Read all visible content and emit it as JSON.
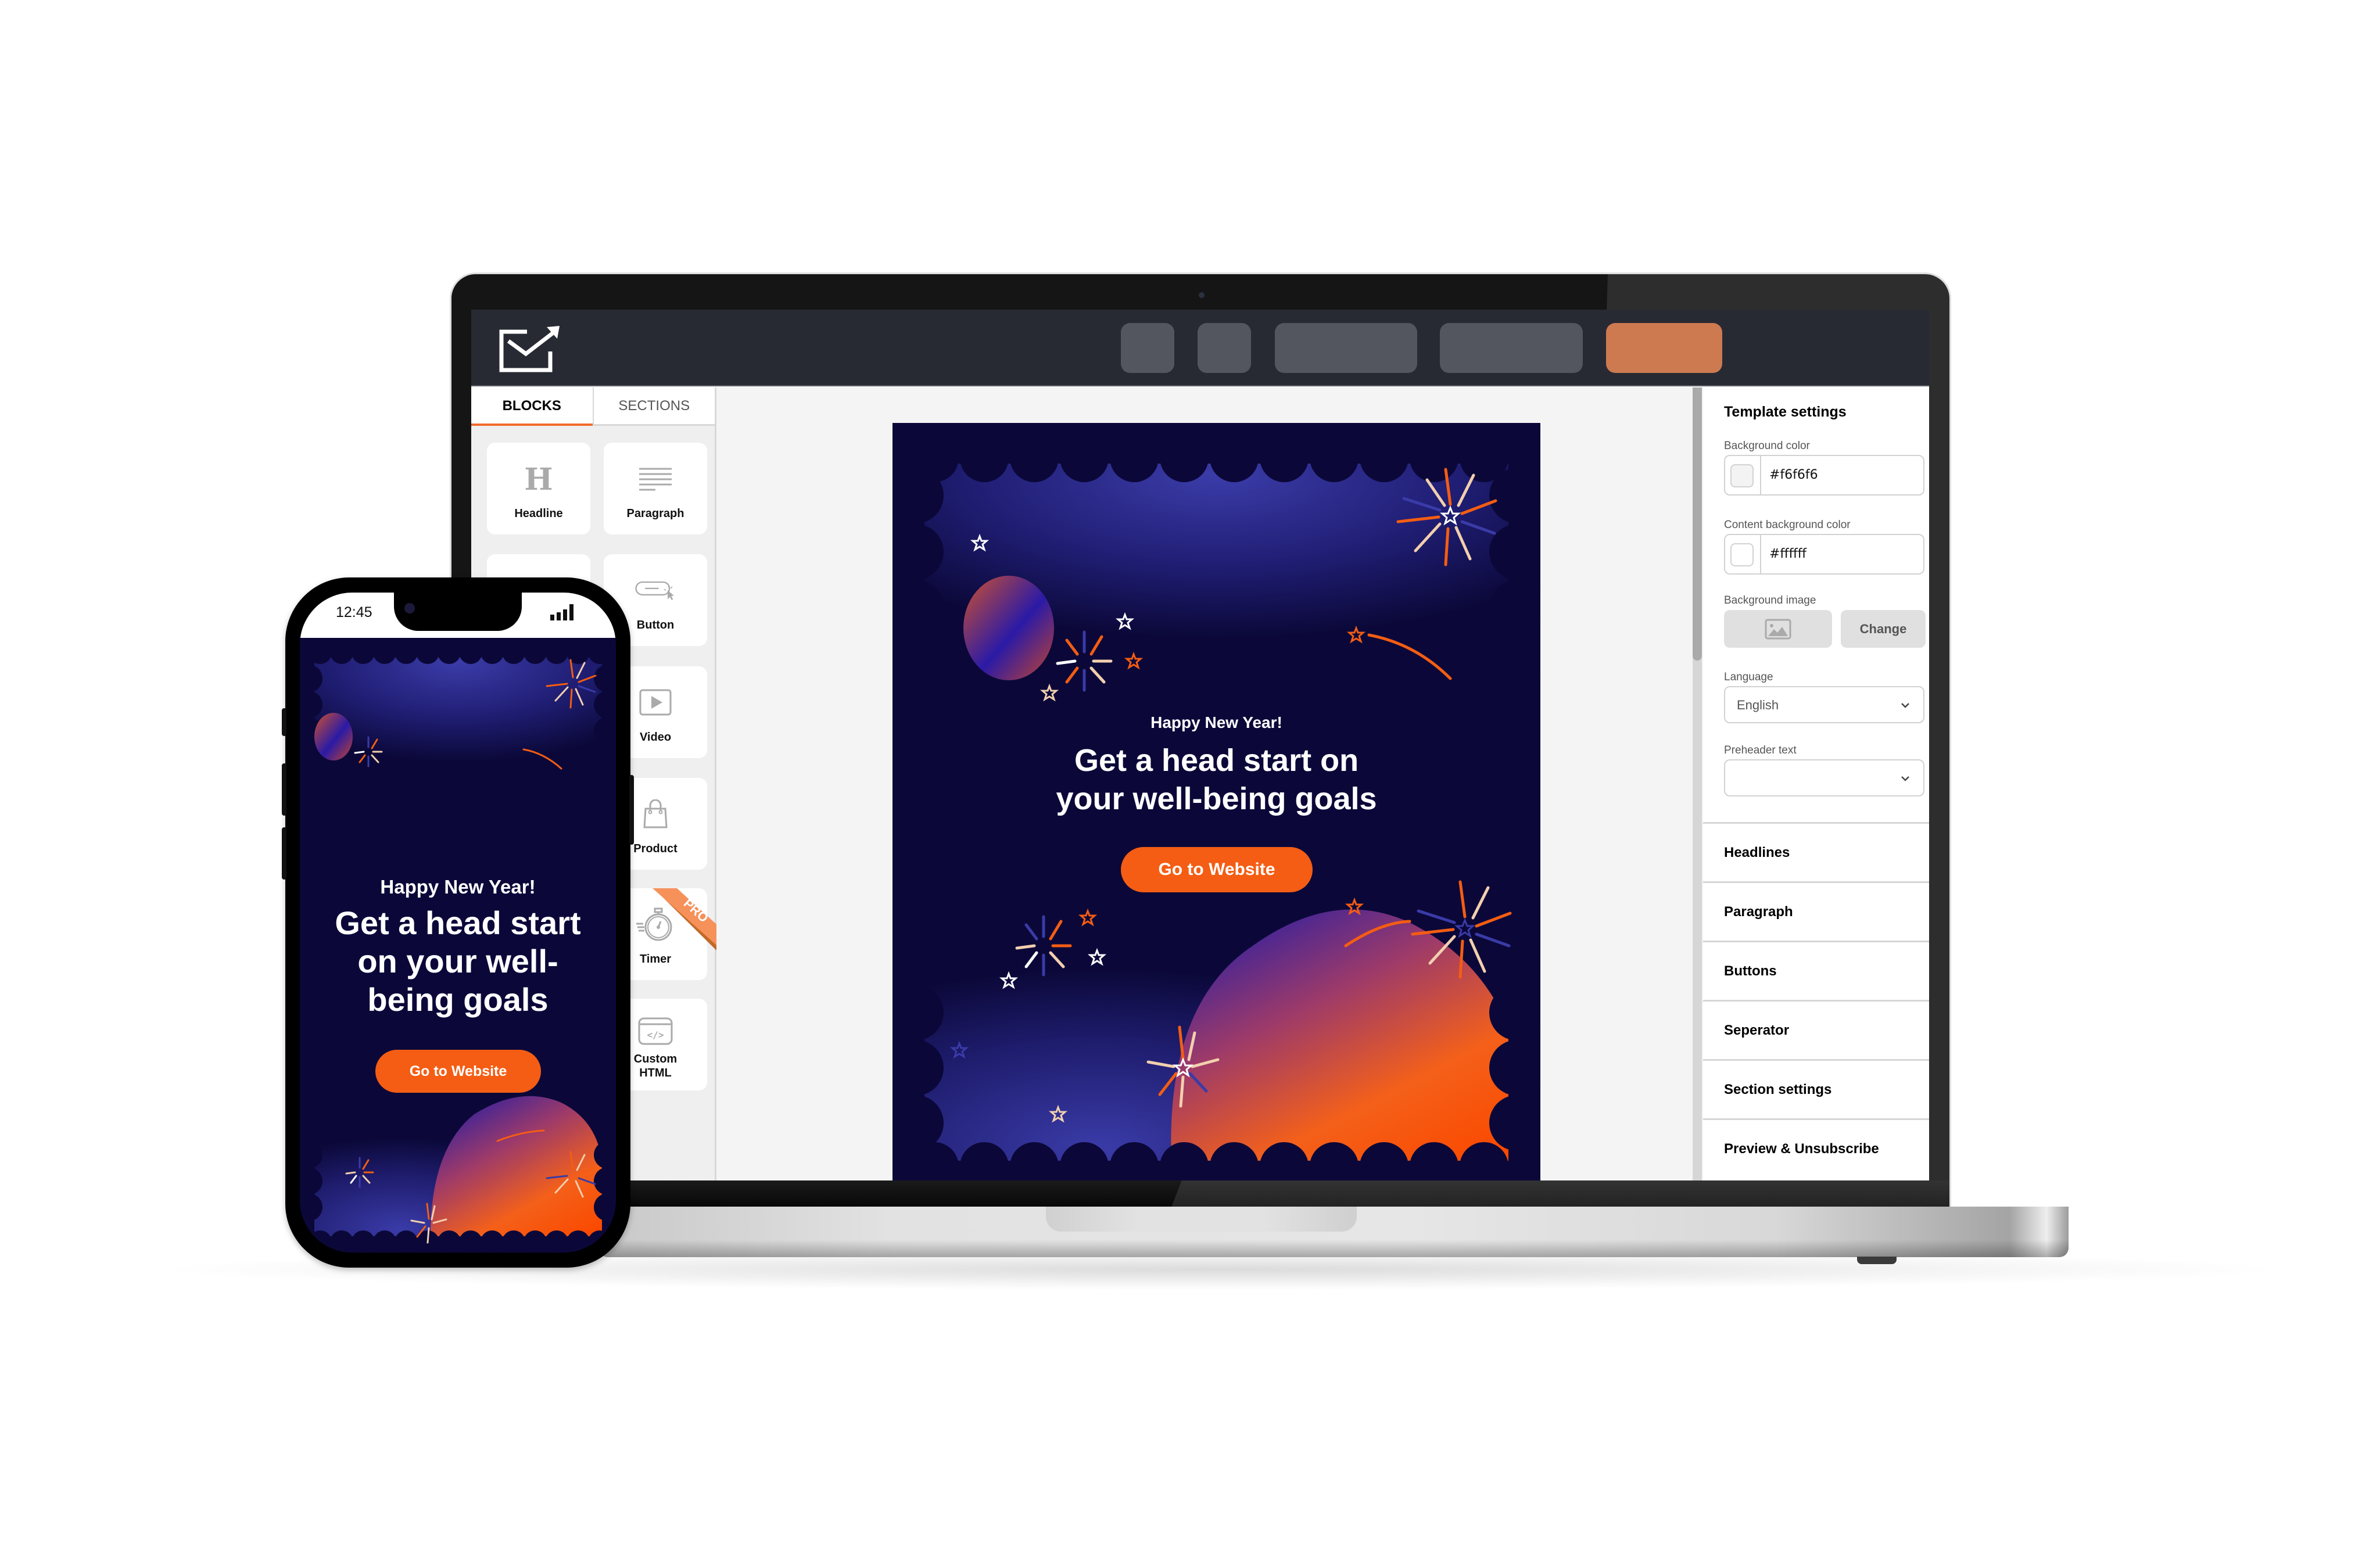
{
  "app": {
    "logo_icon": "envelope-arrow-icon",
    "header_buttons": [
      {
        "name": "header-button-1",
        "label": ""
      },
      {
        "name": "header-button-2",
        "label": ""
      },
      {
        "name": "header-button-3",
        "label": ""
      },
      {
        "name": "header-button-4",
        "label": ""
      },
      {
        "name": "header-button-primary",
        "label": "",
        "color": "#cd7a50"
      }
    ]
  },
  "blocks_panel": {
    "tabs": [
      {
        "label": "BLOCKS",
        "active": true
      },
      {
        "label": "SECTIONS",
        "active": false
      }
    ],
    "tiles": [
      {
        "label": "Headline",
        "icon": "headline-icon"
      },
      {
        "label": "Paragraph",
        "icon": "paragraph-icon"
      },
      {
        "label": "",
        "icon": "image-icon"
      },
      {
        "label": "Button",
        "icon": "button-icon"
      },
      {
        "label": "",
        "icon": "blank-icon"
      },
      {
        "label": "Video",
        "icon": "video-icon"
      },
      {
        "label": "",
        "icon": "blank-icon"
      },
      {
        "label": "Product",
        "icon": "shopping-bag-icon"
      },
      {
        "label": "",
        "icon": "blank-icon"
      },
      {
        "label": "Timer",
        "icon": "stopwatch-icon",
        "badge": "PRO"
      },
      {
        "label": "",
        "icon": "blank-icon"
      },
      {
        "label": "Custom HTML",
        "icon": "code-icon"
      }
    ]
  },
  "email": {
    "greeting": "Happy New Year!",
    "headline": "Get a head start on your well-being goals",
    "cta_label": "Go to Website",
    "colors": {
      "background": "#0b0839",
      "accent": "#f45d13",
      "violet": "#3a3ba8"
    }
  },
  "settings_panel": {
    "title": "Template settings",
    "background_color": {
      "label": "Background color",
      "value": "#f6f6f6"
    },
    "content_background_color": {
      "label": "Content background color",
      "value": "#ffffff"
    },
    "background_image": {
      "label": "Background image",
      "change_label": "Change"
    },
    "language": {
      "label": "Language",
      "value": "English"
    },
    "preheader": {
      "label": "Preheader text",
      "value": ""
    },
    "sections": [
      {
        "label": "Headlines"
      },
      {
        "label": "Paragraph"
      },
      {
        "label": "Buttons"
      },
      {
        "label": "Seperator"
      },
      {
        "label": "Section settings"
      },
      {
        "label": "Preview & Unsubscribe"
      }
    ]
  },
  "phone": {
    "time": "12:45",
    "greeting": "Happy New Year!",
    "headline": "Get a head start on your well-being goals",
    "cta_label": "Go to Website"
  }
}
